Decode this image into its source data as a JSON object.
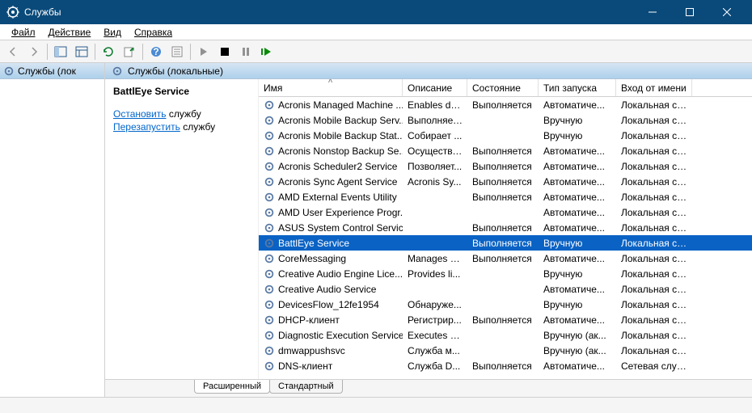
{
  "window": {
    "title": "Службы"
  },
  "menu": {
    "file": "Файл",
    "action": "Действие",
    "view": "Вид",
    "help": "Справка"
  },
  "tree": {
    "root": "Службы (лок"
  },
  "header": "Службы (локальные)",
  "detail": {
    "selected_name": "BattlEye Service",
    "stop_link": "Остановить",
    "stop_suffix": " службу",
    "restart_link": "Перезапустить",
    "restart_suffix": " службу"
  },
  "columns": {
    "name": "Имя",
    "desc": "Описание",
    "state": "Состояние",
    "start": "Тип запуска",
    "logon": "Вход от имени"
  },
  "services": [
    {
      "name": "Acronis Managed Machine ...",
      "desc": "Enables da...",
      "state": "Выполняется",
      "start": "Автоматиче...",
      "logon": "Локальная сис..."
    },
    {
      "name": "Acronis Mobile Backup Serv...",
      "desc": "Выполняет...",
      "state": "",
      "start": "Вручную",
      "logon": "Локальная сис..."
    },
    {
      "name": "Acronis Mobile Backup Stat...",
      "desc": "Собирает ...",
      "state": "",
      "start": "Вручную",
      "logon": "Локальная сис..."
    },
    {
      "name": "Acronis Nonstop Backup Se...",
      "desc": "Осуществл...",
      "state": "Выполняется",
      "start": "Автоматиче...",
      "logon": "Локальная сис..."
    },
    {
      "name": "Acronis Scheduler2 Service",
      "desc": "Позволяет...",
      "state": "Выполняется",
      "start": "Автоматиче...",
      "logon": "Локальная сис..."
    },
    {
      "name": "Acronis Sync Agent Service",
      "desc": "Acronis Sy...",
      "state": "Выполняется",
      "start": "Автоматиче...",
      "logon": "Локальная сис..."
    },
    {
      "name": "AMD External Events Utility",
      "desc": "",
      "state": "Выполняется",
      "start": "Автоматиче...",
      "logon": "Локальная сис..."
    },
    {
      "name": "AMD User Experience Progr...",
      "desc": "",
      "state": "",
      "start": "Автоматиче...",
      "logon": "Локальная сис..."
    },
    {
      "name": "ASUS System Control Service",
      "desc": "",
      "state": "Выполняется",
      "start": "Автоматиче...",
      "logon": "Локальная сис..."
    },
    {
      "name": "BattlEye Service",
      "desc": "",
      "state": "Выполняется",
      "start": "Вручную",
      "logon": "Локальная сис...",
      "selected": true
    },
    {
      "name": "CoreMessaging",
      "desc": "Manages c...",
      "state": "Выполняется",
      "start": "Автоматиче...",
      "logon": "Локальная слу..."
    },
    {
      "name": "Creative Audio Engine Lice...",
      "desc": "Provides li...",
      "state": "",
      "start": "Вручную",
      "logon": "Локальная сис..."
    },
    {
      "name": "Creative Audio Service",
      "desc": "",
      "state": "",
      "start": "Автоматиче...",
      "logon": "Локальная сис..."
    },
    {
      "name": "DevicesFlow_12fe1954",
      "desc": "Обнаруже...",
      "state": "",
      "start": "Вручную",
      "logon": "Локальная сис..."
    },
    {
      "name": "DHCP-клиент",
      "desc": "Регистрир...",
      "state": "Выполняется",
      "start": "Автоматиче...",
      "logon": "Локальная слу..."
    },
    {
      "name": "Diagnostic Execution Service",
      "desc": "Executes di...",
      "state": "",
      "start": "Вручную (ак...",
      "logon": "Локальная сис..."
    },
    {
      "name": "dmwappushsvc",
      "desc": "Служба м...",
      "state": "",
      "start": "Вручную (ак...",
      "logon": "Локальная сис..."
    },
    {
      "name": "DNS-клиент",
      "desc": "Служба D...",
      "state": "Выполняется",
      "start": "Автоматиче...",
      "logon": "Сетевая служба"
    }
  ],
  "tabs": {
    "extended": "Расширенный",
    "standard": "Стандартный"
  }
}
